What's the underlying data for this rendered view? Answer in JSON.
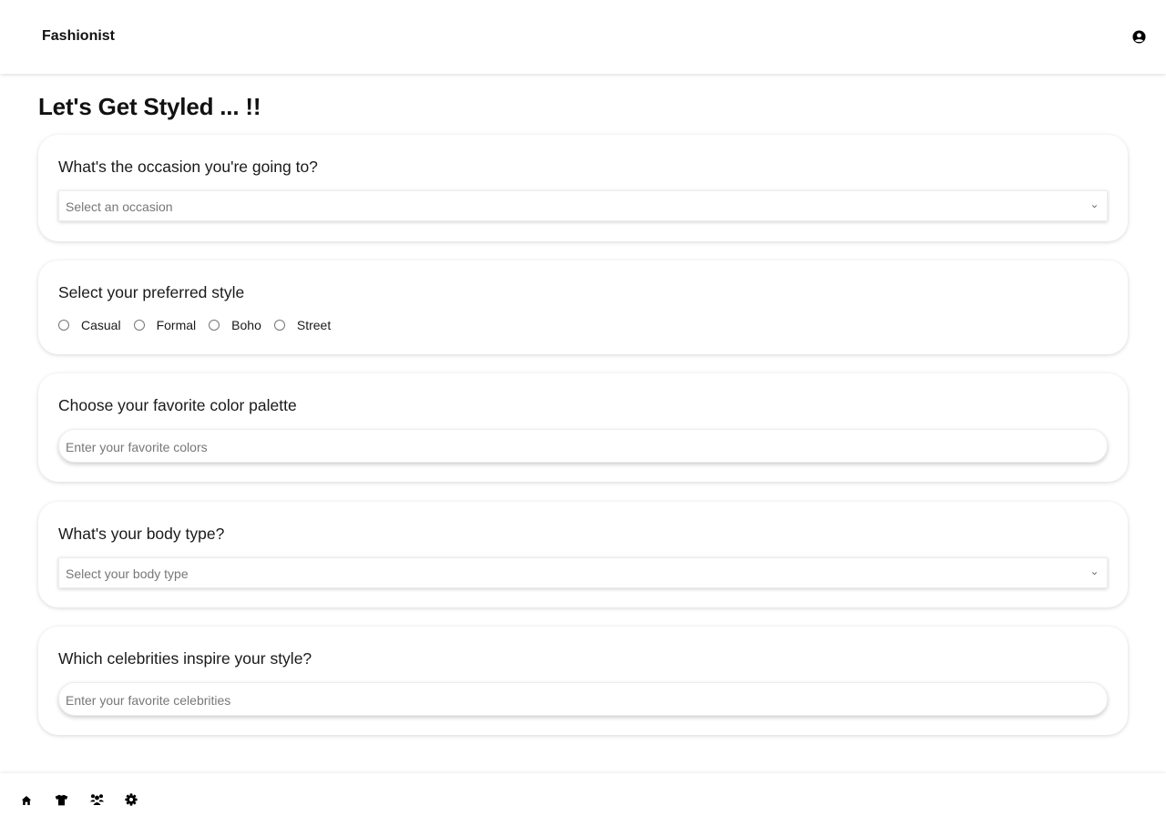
{
  "header": {
    "brand": "Fashionist",
    "account_icon": "user-circle-icon"
  },
  "page": {
    "title": "Let's Get Styled ... !!"
  },
  "occasion": {
    "question": "What's the occasion you're going to?",
    "selected": "Select an occasion"
  },
  "style": {
    "question": "Select your preferred style",
    "options": [
      "Casual",
      "Formal",
      "Boho",
      "Street"
    ]
  },
  "colors": {
    "question": "Choose your favorite color palette",
    "placeholder": "Enter your favorite colors"
  },
  "body_type": {
    "question": "What's your body type?",
    "selected": "Select your body type"
  },
  "celebrities": {
    "question": "Which celebrities inspire your style?",
    "placeholder": "Enter your favorite celebrities"
  },
  "bottom_nav": {
    "items": [
      "home-icon",
      "shirt-icon",
      "users-icon",
      "gear-icon"
    ]
  }
}
